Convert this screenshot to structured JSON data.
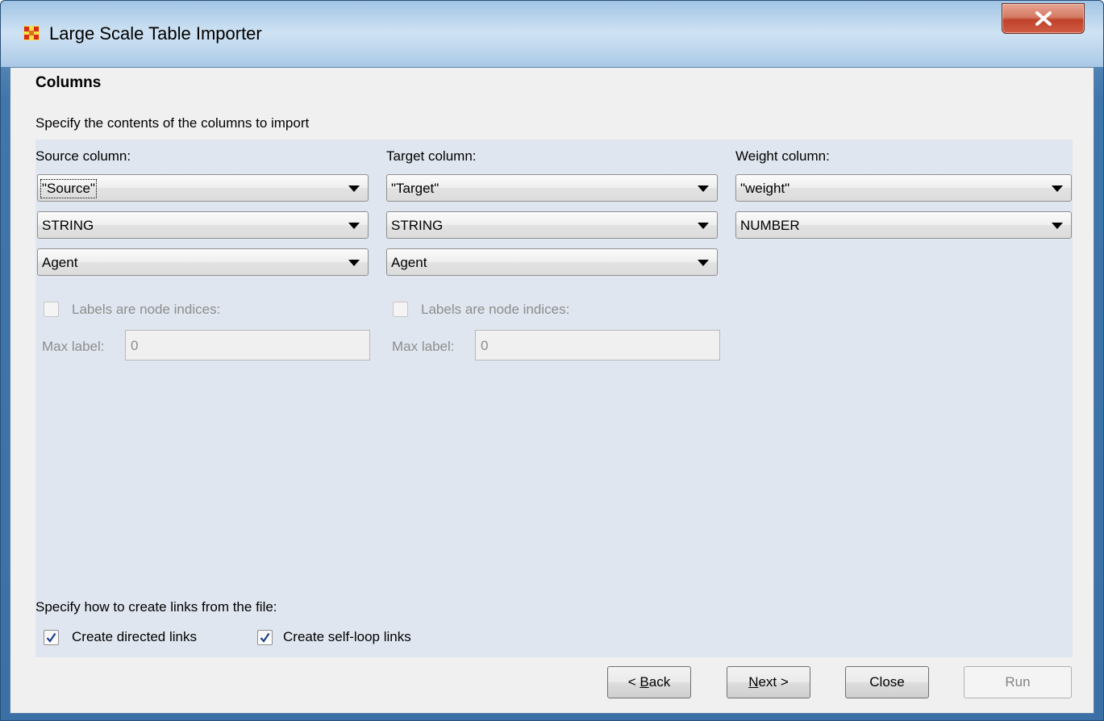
{
  "window": {
    "title": "Large Scale Table Importer",
    "close_glyph": "X"
  },
  "page": {
    "heading": "Columns",
    "description": "Specify the contents of the columns to import"
  },
  "columns": [
    {
      "header": "Source column:",
      "column_select": "\"Source\"",
      "type_select": "STRING",
      "nodeclass_select": "Agent",
      "labels_checkbox": {
        "label": "Labels are node indices:",
        "checked": false,
        "enabled": false
      },
      "max_label": {
        "label": "Max label:",
        "value": "0"
      }
    },
    {
      "header": "Target column:",
      "column_select": "\"Target\"",
      "type_select": "STRING",
      "nodeclass_select": "Agent",
      "labels_checkbox": {
        "label": "Labels are node indices:",
        "checked": false,
        "enabled": false
      },
      "max_label": {
        "label": "Max label:",
        "value": "0"
      }
    },
    {
      "header": "Weight column:",
      "column_select": "\"weight\"",
      "type_select": "NUMBER"
    }
  ],
  "links": {
    "prompt": "Specify how to create links from the file:",
    "directed": {
      "label": "Create directed links",
      "checked": true
    },
    "self_loop": {
      "label": "Create self-loop links",
      "checked": true
    }
  },
  "buttons": {
    "back": {
      "prefix": "< ",
      "mnemonic": "B",
      "rest": "ack"
    },
    "next": {
      "mnemonic": "N",
      "rest": "ext >"
    },
    "close": "Close",
    "run": "Run"
  },
  "icons": {
    "app": "ora-network-icon",
    "dropdown": "chevron-down-icon",
    "check": "checkmark-icon",
    "close": "close-icon"
  }
}
